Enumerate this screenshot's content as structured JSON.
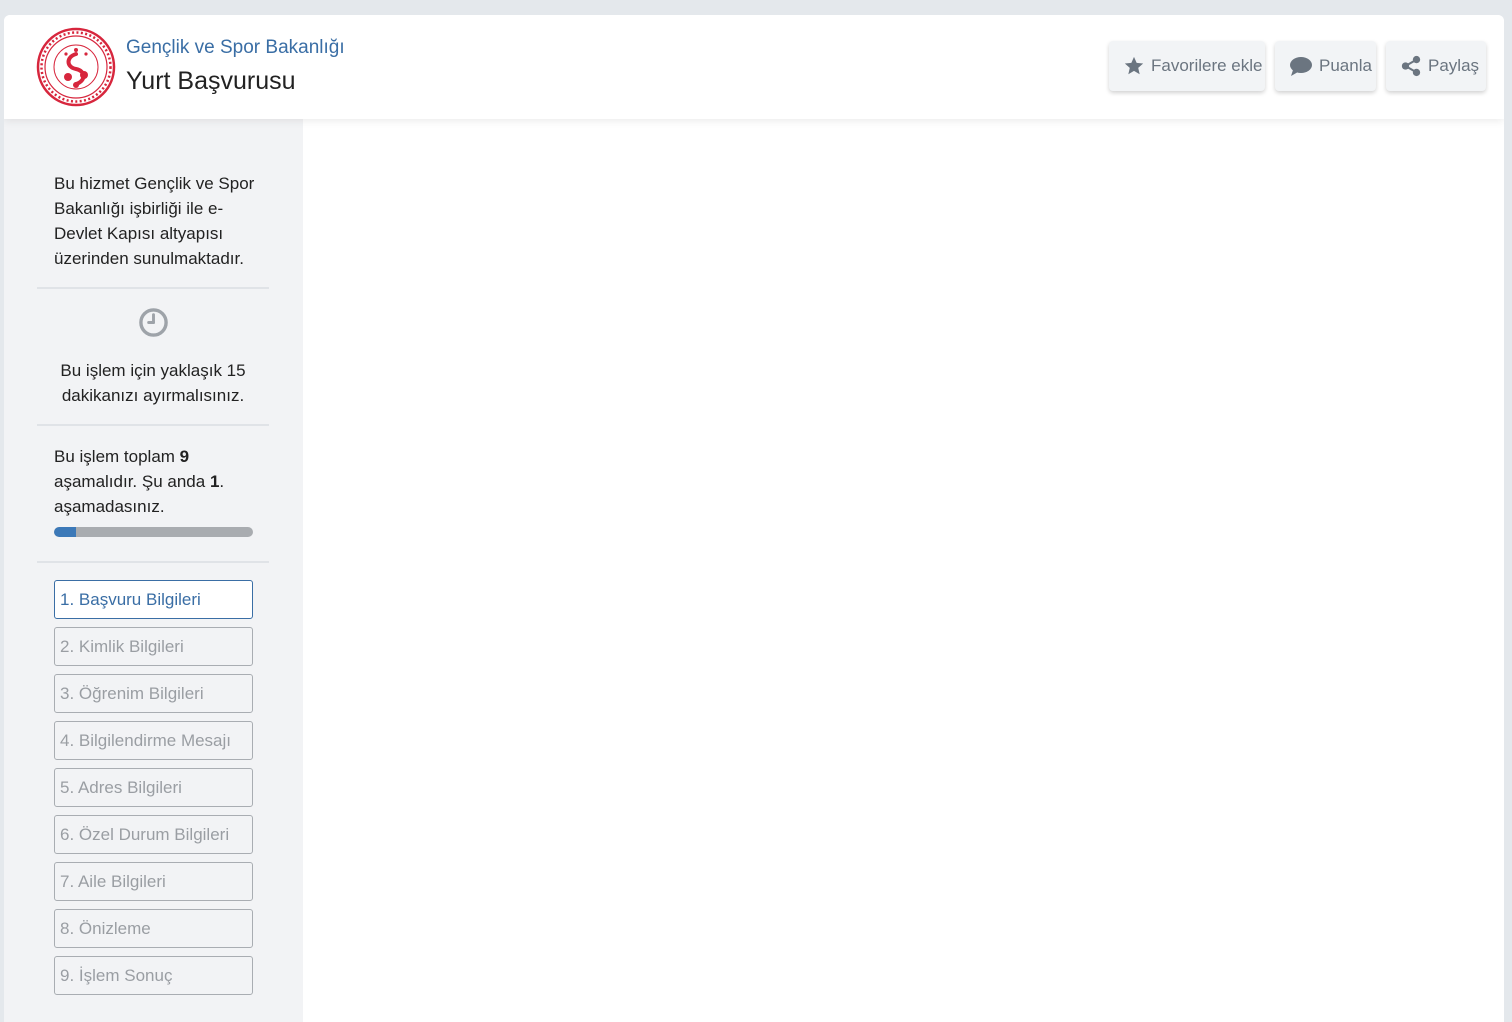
{
  "header": {
    "org_name": "Gençlik ve Spor Bakanlığı",
    "service_title": "Yurt Başvurusu",
    "favorite_label": "Favorilere ekle",
    "rate_label": "Puanla",
    "share_label": "Paylaş"
  },
  "sidebar": {
    "info_text": "Bu hizmet Gençlik ve Spor Bakanlığı işbirliği ile e-Devlet Kapısı altyapısı üzerinden sunulmaktadır.",
    "duration_text": "Bu işlem için yaklaşık 15 dakikanızı ayırmalısınız.",
    "steps_prefix": "Bu işlem toplam ",
    "total_steps": "9",
    "steps_middle": " aşamalıdır. Şu anda ",
    "current_step": "1",
    "steps_suffix": ". aşamadasınız.",
    "progress_fraction": 0.111,
    "steps": [
      {
        "label": "1. Başvuru Bilgileri",
        "active": true
      },
      {
        "label": "2. Kimlik Bilgileri",
        "active": false
      },
      {
        "label": "3. Öğrenim Bilgileri",
        "active": false
      },
      {
        "label": "4. Bilgilendirme Mesajı",
        "active": false
      },
      {
        "label": "5. Adres Bilgileri",
        "active": false
      },
      {
        "label": "6. Özel Durum Bilgileri",
        "active": false
      },
      {
        "label": "7. Aile Bilgileri",
        "active": false
      },
      {
        "label": "8. Önizleme",
        "active": false
      },
      {
        "label": "9. İşlem Sonuç",
        "active": false
      }
    ]
  },
  "colors": {
    "accent": "#3a6ea5",
    "progress_fill": "#3c79b8",
    "logo_red": "#d7263d"
  },
  "icons": {
    "logo": "ministry-emblem",
    "favorite": "star-icon",
    "rate": "speech-bubble-icon",
    "share": "share-icon",
    "duration": "clock-icon"
  }
}
